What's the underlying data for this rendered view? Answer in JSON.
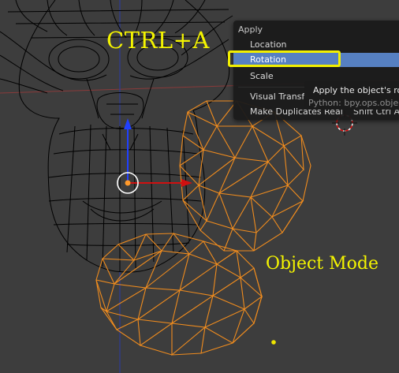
{
  "overlays": {
    "shortcut_caption": "CTRL+A",
    "mode_caption": "Object Mode"
  },
  "apply_menu": {
    "title": "Apply",
    "items": [
      {
        "label": "Location",
        "shortcut": "",
        "active": false
      },
      {
        "label": "Rotation",
        "shortcut": "",
        "active": true
      },
      {
        "label": "Scale",
        "shortcut": "",
        "active": false
      },
      {
        "label": "Visual Transfo",
        "shortcut": "",
        "active": false
      },
      {
        "label": "Make Duplicates Real",
        "shortcut": "Shift Ctrl A",
        "active": false
      }
    ]
  },
  "tooltip": {
    "description": "Apply the object's rota",
    "python": "Python: bpy.ops.object."
  },
  "colors": {
    "viewport_bg": "#3d3d3d",
    "wire_black": "#000000",
    "wire_selected": "#f08c1e",
    "menu_highlight": "#5680c2",
    "annotation_yellow": "#f4f400",
    "axis_red": "#d01010",
    "axis_blue": "#2040ff"
  },
  "icons": [
    "3d-cursor-icon",
    "origin-dot-icon",
    "translate-x-arrow-icon",
    "translate-z-arrow-icon",
    "lamp-icon"
  ]
}
